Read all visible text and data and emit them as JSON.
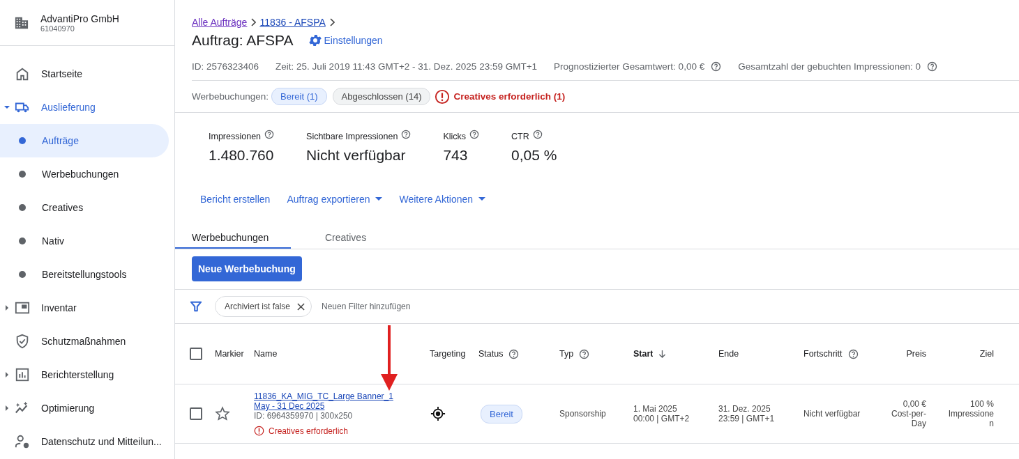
{
  "account": {
    "name": "AdvantiPro GmbH",
    "id": "61040970"
  },
  "sidebar": {
    "items": [
      {
        "label": "Startseite",
        "selected": false
      },
      {
        "label": "Auslieferung",
        "selected": false,
        "expanded": true,
        "children": [
          {
            "label": "Aufträge",
            "selected": true
          },
          {
            "label": "Werbebuchungen",
            "selected": false
          },
          {
            "label": "Creatives",
            "selected": false
          },
          {
            "label": "Nativ",
            "selected": false
          },
          {
            "label": "Bereitstellungstools",
            "selected": false
          }
        ]
      },
      {
        "label": "Inventar",
        "selected": false,
        "expanded": false
      },
      {
        "label": "Schutzmaßnahmen",
        "selected": false
      },
      {
        "label": "Berichterstellung",
        "selected": false,
        "expanded": false
      },
      {
        "label": "Optimierung",
        "selected": false,
        "expanded": false
      },
      {
        "label": "Datenschutz und Mitteilun...",
        "selected": false
      }
    ]
  },
  "breadcrumb": [
    {
      "label": "Alle Aufträge",
      "visited": true
    },
    {
      "label": "11836 - AFSPA",
      "visited": false
    }
  ],
  "page_title": "Auftrag: AFSPA",
  "settings_link": "Einstellungen",
  "meta": [
    {
      "text": "ID: 2576323406",
      "help": false
    },
    {
      "text": "Zeit: 25. Juli 2019 11:43 GMT+2 - 31. Dez. 2025 23:59 GMT+1",
      "help": false
    },
    {
      "text": "Prognostizierter Gesamtwert: 0,00 €",
      "help": true
    },
    {
      "text": "Gesamtzahl der gebuchten Impressionen: 0",
      "help": true
    }
  ],
  "line_items_filter": {
    "label": "Werbebuchungen:",
    "chips": [
      {
        "label": "Bereit (1)",
        "selected": true
      },
      {
        "label": "Abgeschlossen (14)",
        "selected": false
      }
    ],
    "warning": "Creatives erforderlich (1)"
  },
  "stats": [
    {
      "label": "Impressionen",
      "value": "1.480.760"
    },
    {
      "label": "Sichtbare Impressionen",
      "value": "Nicht verfügbar"
    },
    {
      "label": "Klicks",
      "value": "743"
    },
    {
      "label": "CTR",
      "value": "0,05 %"
    }
  ],
  "actions": [
    {
      "label": "Bericht erstellen",
      "dropdown": false
    },
    {
      "label": "Auftrag exportieren",
      "dropdown": true
    },
    {
      "label": "Weitere Aktionen",
      "dropdown": true
    }
  ],
  "tabs": [
    {
      "label": "Werbebuchungen",
      "selected": true
    },
    {
      "label": "Creatives",
      "selected": false
    }
  ],
  "new_button": "Neue Werbebuchung",
  "filters": {
    "chips": [
      {
        "label": "Archiviert ist false"
      }
    ],
    "add_placeholder": "Neuen Filter hinzufügen"
  },
  "table": {
    "select_all_checked": false,
    "columns": [
      {
        "label": "Markier",
        "help": false,
        "sorted": false
      },
      {
        "label": "Name",
        "help": false,
        "sorted": false
      },
      {
        "label": "Targeting",
        "help": false,
        "sorted": false
      },
      {
        "label": "Status",
        "help": true,
        "sorted": false
      },
      {
        "label": "Typ",
        "help": true,
        "sorted": false
      },
      {
        "label": "Start",
        "help": false,
        "sorted": true
      },
      {
        "label": "Ende",
        "help": false,
        "sorted": false
      },
      {
        "label": "Fortschritt",
        "help": true,
        "sorted": false
      },
      {
        "label": "Preis",
        "help": false,
        "sorted": false
      },
      {
        "label": "Ziel",
        "help": false,
        "sorted": false
      }
    ],
    "rows": [
      {
        "checked": false,
        "starred": false,
        "name": "11836_KA_MIG_TC_Large Banner_1 May - 31 Dec 2025",
        "detail": "ID: 6964359970 | 300x250",
        "warning": "Creatives erforderlich",
        "status": "Bereit",
        "type": "Sponsorship",
        "start": [
          "1. Mai 2025",
          "00:00 | GMT+2"
        ],
        "end": [
          "31. Dez. 2025",
          "23:59 | GMT+1"
        ],
        "progress": "Nicht verfügbar",
        "price": [
          "0,00 €",
          "Cost-per-Day"
        ],
        "goal": [
          "100 %",
          "Impressionen"
        ]
      }
    ]
  }
}
